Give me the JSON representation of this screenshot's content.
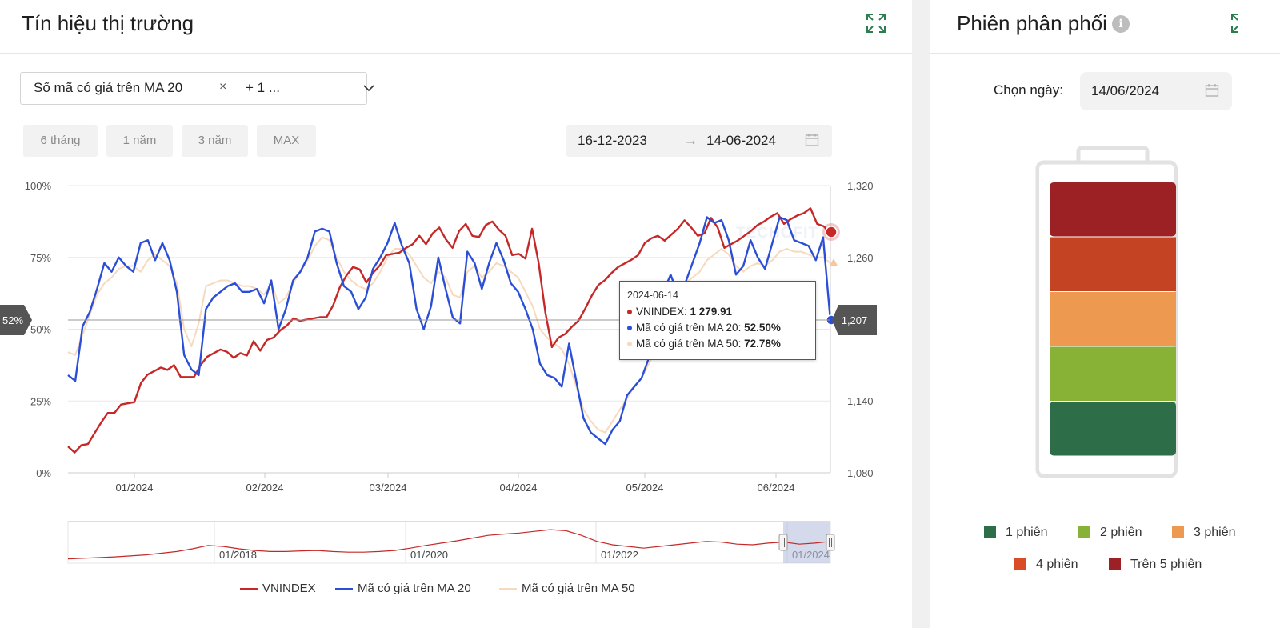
{
  "left_panel": {
    "title": "Tín hiệu thị trường",
    "selector": {
      "tag": "Số mã có giá trên MA 20",
      "more": "+ 1 ..."
    },
    "range_buttons": [
      "6 tháng",
      "1 năm",
      "3 năm",
      "MAX"
    ],
    "date_range": {
      "from": "16-12-2023",
      "arrow": "→",
      "to": "14-06-2024"
    },
    "tooltip": {
      "date": "2024-06-14",
      "rows": [
        {
          "label": "VNINDEX: ",
          "value": "1 279.91",
          "color": "#c62828"
        },
        {
          "label": "Mã có giá trên MA 20: ",
          "value": "52.50%",
          "color": "#2a4fd6"
        },
        {
          "label": "Mã có giá trên MA 50: ",
          "value": "72.78%",
          "color": "#f7d9bd"
        }
      ]
    },
    "crosshair": {
      "left_label": "52%",
      "right_label": "1,207"
    },
    "watermark": "TECHOFIT"
  },
  "chart_data": {
    "type": "line",
    "x_ticks": [
      "01/2024",
      "02/2024",
      "03/2024",
      "04/2024",
      "05/2024",
      "06/2024"
    ],
    "y_left": {
      "ticks": [
        "100%",
        "75%",
        "50%",
        "25%",
        "0%"
      ],
      "range": [
        0,
        100
      ]
    },
    "y_right": {
      "ticks": [
        "1,320",
        "1,260",
        "1,207",
        "1,140",
        "1,080"
      ],
      "range": [
        1080,
        1320
      ]
    },
    "series": [
      {
        "name": "VNINDEX",
        "axis": "right",
        "color": "#c62828",
        "values": [
          1102,
          1097,
          1103,
          1104,
          1113,
          1122,
          1130,
          1130,
          1137,
          1138,
          1139,
          1155,
          1162,
          1165,
          1168,
          1166,
          1170,
          1160,
          1160,
          1160,
          1170,
          1177,
          1180,
          1183,
          1181,
          1176,
          1180,
          1178,
          1190,
          1182,
          1191,
          1193,
          1199,
          1203,
          1209,
          1207,
          1208,
          1209,
          1210,
          1210,
          1220,
          1235,
          1245,
          1252,
          1250,
          1239,
          1247,
          1253,
          1262,
          1263,
          1264,
          1268,
          1271,
          1278,
          1271,
          1280,
          1285,
          1275,
          1268,
          1282,
          1288,
          1278,
          1277,
          1287,
          1290,
          1283,
          1278,
          1262,
          1263,
          1259,
          1284,
          1255,
          1214,
          1185,
          1193,
          1196,
          1202,
          1207,
          1217,
          1228,
          1237,
          1241,
          1247,
          1252,
          1255,
          1258,
          1262,
          1272,
          1276,
          1278,
          1274,
          1279,
          1284,
          1291,
          1285,
          1278,
          1280,
          1293,
          1285,
          1268,
          1271,
          1274,
          1278,
          1282,
          1287,
          1290,
          1294,
          1297,
          1288,
          1292,
          1295,
          1297,
          1301,
          1288,
          1286,
          1280
        ]
      },
      {
        "name": "Mã có giá trên MA 20",
        "axis": "left",
        "color": "#2a4fd6",
        "values": [
          34,
          32,
          51,
          56,
          64,
          73,
          70,
          75,
          72,
          70,
          80,
          81,
          74,
          80,
          74,
          63,
          41,
          36,
          34,
          57,
          61,
          63,
          65,
          66,
          63,
          63,
          64,
          59,
          67,
          50,
          57,
          67,
          70,
          75,
          84,
          85,
          84,
          73,
          65,
          63,
          57,
          61,
          71,
          75,
          80,
          87,
          79,
          73,
          57,
          50,
          58,
          75,
          64,
          54,
          52,
          77,
          73,
          64,
          73,
          80,
          74,
          66,
          63,
          57,
          50,
          38,
          34,
          33,
          30,
          45,
          32,
          19,
          14,
          12,
          10,
          15,
          18,
          27,
          30,
          33,
          40,
          45,
          63,
          69,
          62,
          66,
          73,
          80,
          89,
          87,
          88,
          81,
          69,
          72,
          81,
          75,
          71,
          80,
          89,
          88,
          81,
          80,
          79,
          74,
          82,
          53
        ],
        "note_last": 52.5
      },
      {
        "name": "Mã có giá trên MA 50",
        "axis": "left",
        "color": "#f7d9bd",
        "values": [
          42,
          41,
          48,
          55,
          62,
          66,
          68,
          71,
          72,
          72,
          70,
          74,
          76,
          74,
          72,
          66,
          50,
          44,
          52,
          65,
          66,
          67,
          67,
          66,
          65,
          65,
          64,
          62,
          66,
          59,
          61,
          66,
          70,
          74,
          79,
          82,
          81,
          75,
          70,
          67,
          65,
          64,
          66,
          70,
          75,
          78,
          78,
          76,
          72,
          68,
          66,
          70,
          68,
          62,
          61,
          70,
          72,
          68,
          70,
          73,
          72,
          70,
          68,
          63,
          58,
          50,
          47,
          45,
          43,
          38,
          30,
          22,
          18,
          15,
          14,
          18,
          22,
          26,
          30,
          33,
          38,
          43,
          52,
          60,
          64,
          66,
          68,
          70,
          74,
          76,
          78,
          76,
          72,
          70,
          72,
          73,
          72,
          74,
          77,
          78,
          77,
          77,
          76,
          75,
          75,
          73
        ],
        "note_last": 72.78
      }
    ],
    "navigator": {
      "labels": [
        "01/2018",
        "01/2020",
        "01/2022",
        "01/2024"
      ]
    },
    "legend": [
      "VNINDEX",
      "Mã có giá trên MA 20",
      "Mã có giá trên MA 50"
    ],
    "legend_colors": [
      "#c62828",
      "#2a4fd6",
      "#f7d9bd"
    ]
  },
  "right_panel": {
    "title": "Phiên phân phối",
    "date_label": "Chọn ngày:",
    "date_value": "14/06/2024",
    "battery_colors": [
      "#9c2124",
      "#c44322",
      "#ed9950",
      "#87b236",
      "#2d6e49"
    ],
    "legend": [
      {
        "label": "1 phiên",
        "color": "#2d6e49"
      },
      {
        "label": "2 phiên",
        "color": "#87b236"
      },
      {
        "label": "3 phiên",
        "color": "#ed9950"
      },
      {
        "label": "4 phiên",
        "color": "#d94d26"
      },
      {
        "label": "Trên 5 phiên",
        "color": "#9c2124"
      }
    ]
  }
}
